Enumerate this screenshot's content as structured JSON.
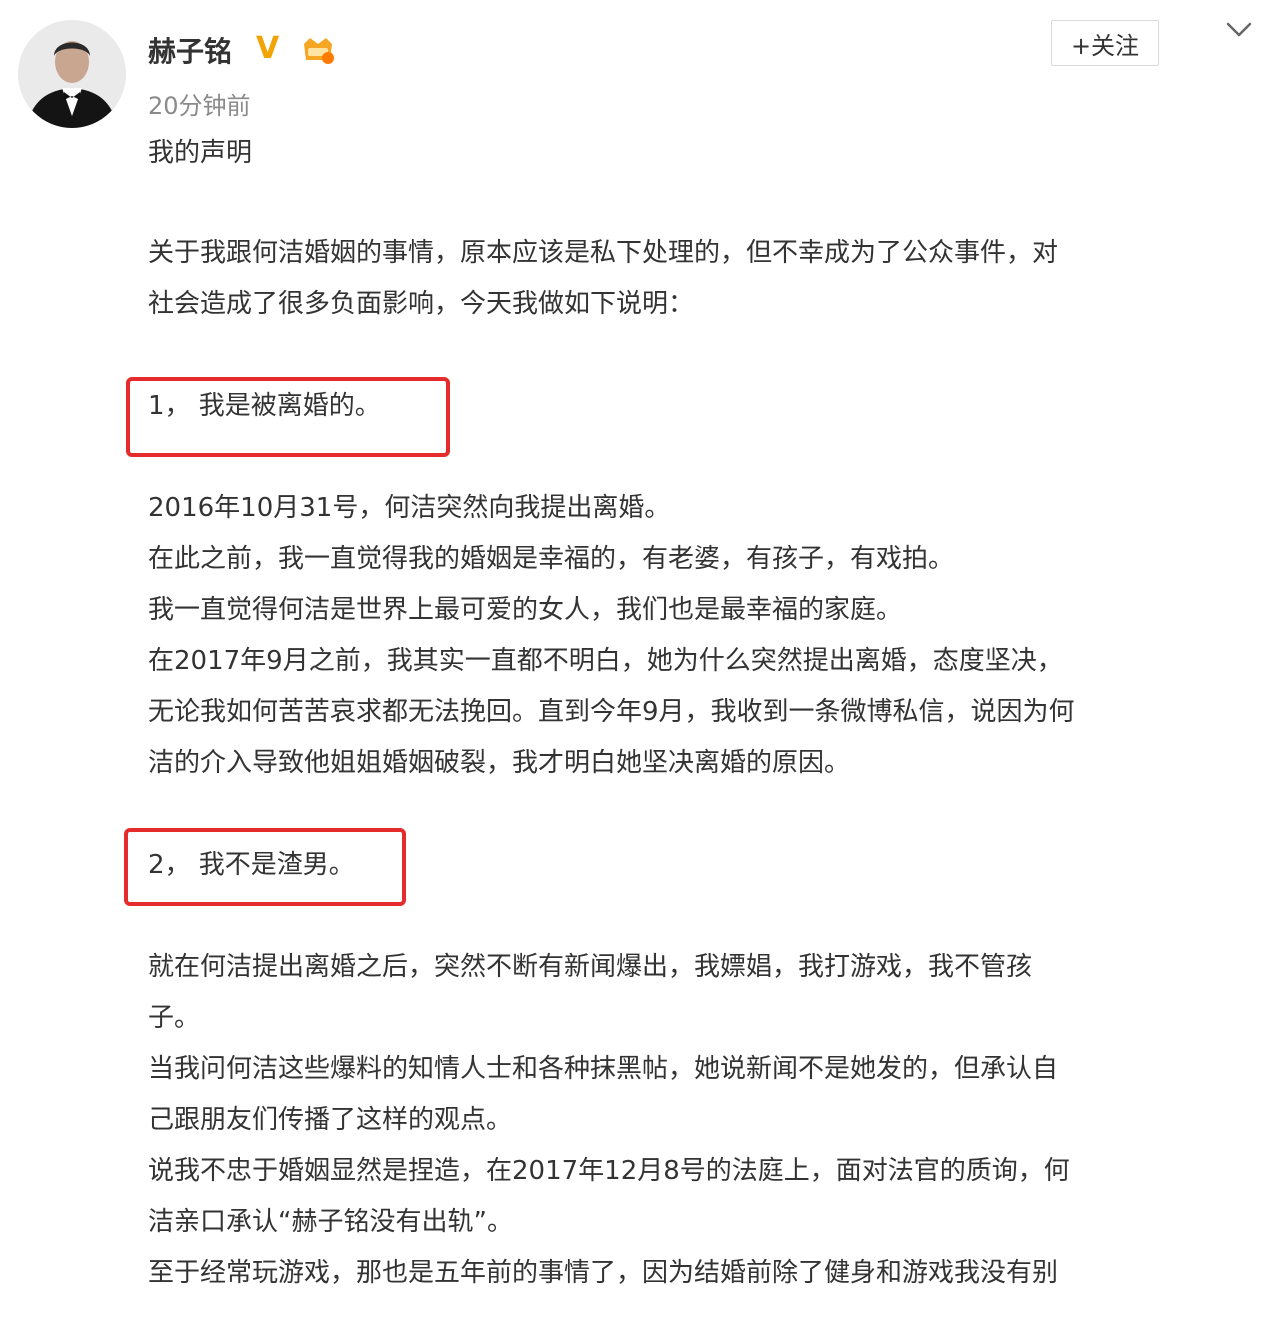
{
  "user": {
    "name": "赫子铭",
    "verified_mark": "V",
    "time": "20分钟前"
  },
  "actions": {
    "follow_label": "+关注"
  },
  "post": {
    "title": "我的声明",
    "intro": [
      "关于我跟何洁婚姻的事情，原本应该是私下处理的，但不幸成为了公众事件，对",
      "社会造成了很多负面影响，今天我做如下说明："
    ],
    "point1": "1，  我是被离婚的。",
    "section1": [
      "2016年10月31号，何洁突然向我提出离婚。",
      "在此之前，我一直觉得我的婚姻是幸福的，有老婆，有孩子，有戏拍。",
      "我一直觉得何洁是世界上最可爱的女人，我们也是最幸福的家庭。",
      "在2017年9月之前，我其实一直都不明白，她为什么突然提出离婚，态度坚决，",
      "无论我如何苦苦哀求都无法挽回。直到今年9月，我收到一条微博私信，说因为何",
      "洁的介入导致他姐姐婚姻破裂，我才明白她坚决离婚的原因。"
    ],
    "point2": "2，  我不是渣男。",
    "section2": [
      "就在何洁提出离婚之后，突然不断有新闻爆出，我嫖娼，我打游戏，我不管孩",
      "子。",
      "当我问何洁这些爆料的知情人士和各种抹黑帖，她说新闻不是她发的，但承认自",
      "己跟朋友们传播了这样的观点。",
      "说我不忠于婚姻显然是捏造，在2017年12月8号的法庭上，面对法官的质询，何",
      "洁亲口承认“赫子铭没有出轨”。",
      "至于经常玩游戏，那也是五年前的事情了，因为结婚前除了健身和游戏我没有别"
    ]
  },
  "colors": {
    "highlight": "#e52b2b",
    "verified": "#f1a405",
    "follow_plus": "#ff8200"
  },
  "icons": [
    "avatar",
    "verified-v-icon",
    "vip-icon",
    "chevron-down-icon"
  ]
}
